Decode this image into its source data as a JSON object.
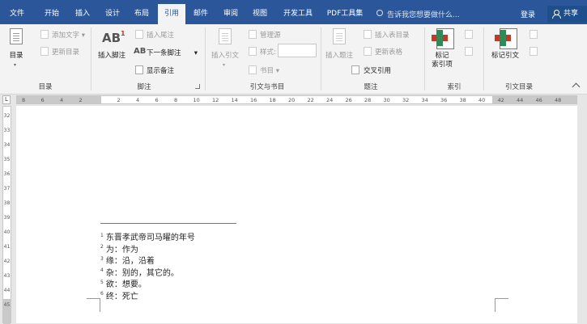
{
  "tabs": [
    {
      "label": "文件",
      "active": false
    },
    {
      "label": "开始",
      "active": false
    },
    {
      "label": "插入",
      "active": false
    },
    {
      "label": "设计",
      "active": false
    },
    {
      "label": "布局",
      "active": false
    },
    {
      "label": "引用",
      "active": true
    },
    {
      "label": "邮件",
      "active": false
    },
    {
      "label": "审阅",
      "active": false
    },
    {
      "label": "视图",
      "active": false
    },
    {
      "label": "开发工具",
      "active": false
    },
    {
      "label": "PDF工具集",
      "active": false
    }
  ],
  "tell_me": "告诉我您想要做什么...",
  "login": "登录",
  "share": "共享",
  "ribbon": {
    "toc": {
      "big_button": "目录",
      "add_text": "添加文字",
      "update_toc": "更新目录",
      "group_label": "目录"
    },
    "footnotes": {
      "insert_footnote": "插入脚注",
      "insert_endnote": "插入尾注",
      "next_footnote": "下一条脚注",
      "show_notes": "显示备注",
      "group_label": "脚注",
      "ab_text": "AB",
      "ab_sup": "1",
      "ab_small": "AB"
    },
    "citations": {
      "insert_citation": "插入引文",
      "manage_sources": "管理源",
      "style_label": "样式:",
      "bibliography": "书目",
      "group_label": "引文与书目"
    },
    "captions": {
      "insert_caption": "插入题注",
      "insert_table_of_figures": "插入表目录",
      "update_table": "更新表格",
      "cross_reference": "交叉引用",
      "group_label": "题注"
    },
    "index": {
      "mark_entry": "标记\n索引项",
      "group_label": "索引"
    },
    "authorities": {
      "mark_citation": "标记引文",
      "group_label": "引文目录"
    }
  },
  "ruler": {
    "tab_selector": "L",
    "h_numbers": [
      "8",
      "6",
      "4",
      "2",
      "",
      "2",
      "4",
      "6",
      "8",
      "10",
      "12",
      "14",
      "16",
      "18",
      "20",
      "22",
      "24",
      "26",
      "28",
      "30",
      "32",
      "34",
      "36",
      "38",
      "40",
      "42",
      "44",
      "46",
      "48"
    ],
    "v_numbers": [
      "32",
      "33",
      "34",
      "35",
      "36",
      "37",
      "38",
      "39",
      "40",
      "41",
      "42",
      "43",
      "44",
      "45"
    ]
  },
  "document": {
    "footnotes": [
      {
        "num": "1",
        "text": "东晋孝武帝司马曜的年号"
      },
      {
        "num": "2",
        "text": "为：作为"
      },
      {
        "num": "3",
        "text": "缘：沿，沿着"
      },
      {
        "num": "4",
        "text": "杂：别的，其它的。"
      },
      {
        "num": "5",
        "text": "欲：想要。"
      },
      {
        "num": "6",
        "text": "终：死亡"
      }
    ]
  },
  "colors": {
    "accent": "#2b579a",
    "ribbon_bg": "#f3f3f3"
  }
}
